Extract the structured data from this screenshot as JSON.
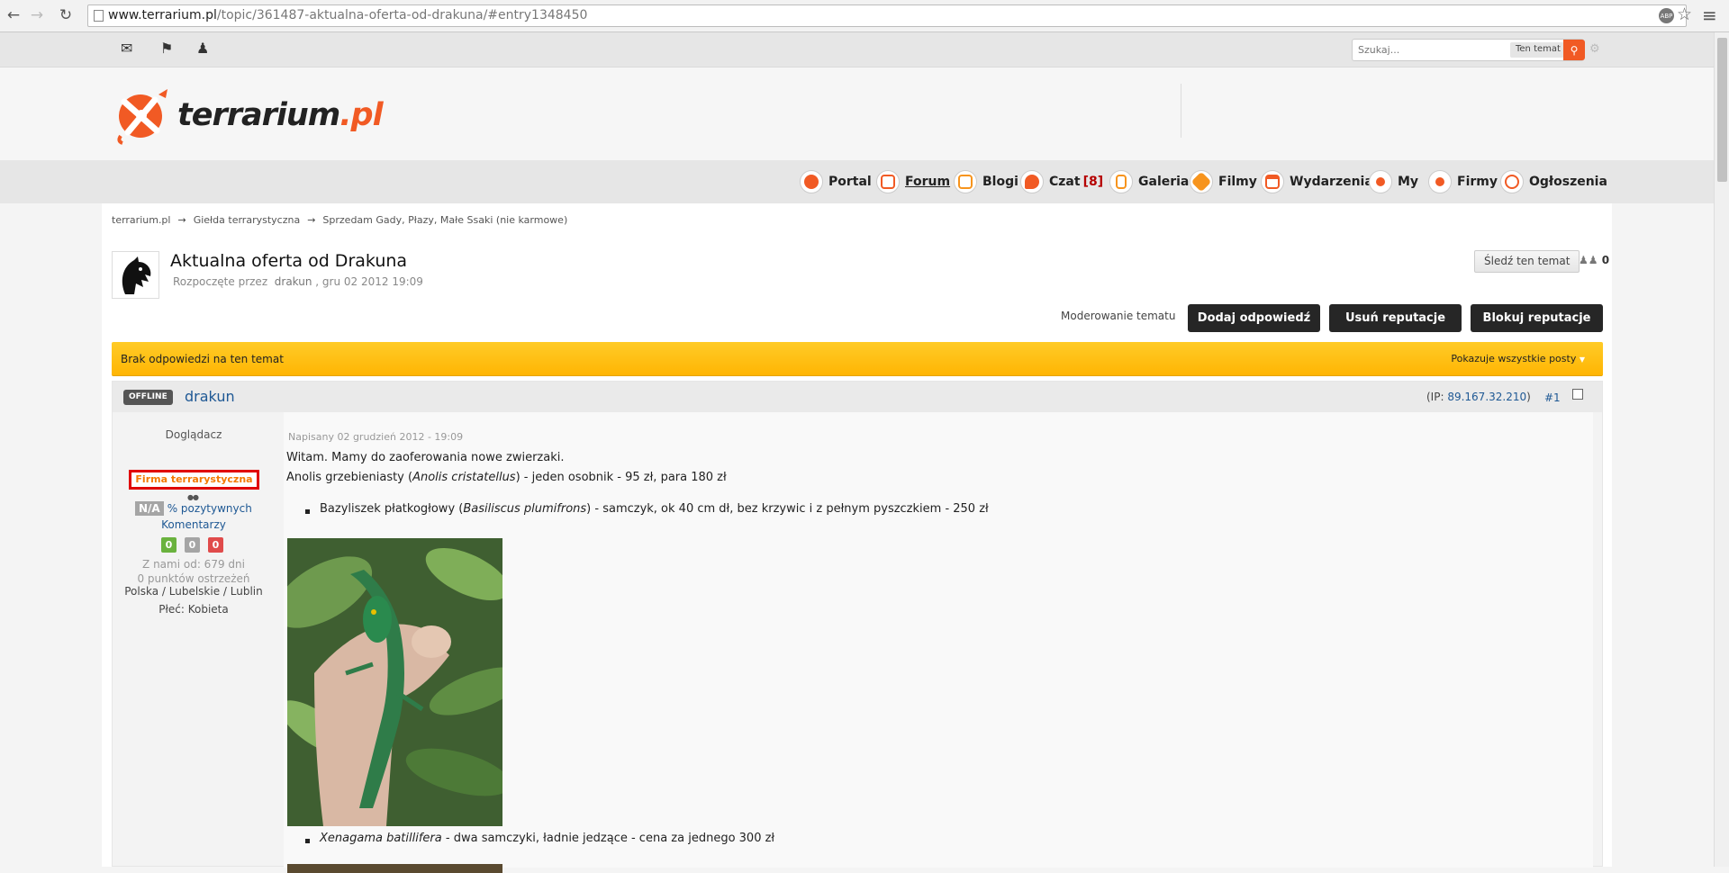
{
  "browser": {
    "url_domain": "www.terrarium.pl",
    "url_path": "/topic/361487-aktualna-oferta-od-drakuna/#entry1348450",
    "ext_label": "ABP"
  },
  "userbar": {
    "search_placeholder": "Szukaj...",
    "search_scope": "Ten temat"
  },
  "site": {
    "logo_text": "terrarium",
    "logo_suffix": ".pl",
    "brand_color": "#f15a24"
  },
  "nav": [
    {
      "label": "Portal",
      "icon": "portal-icon"
    },
    {
      "label": "Forum",
      "icon": "forum-icon"
    },
    {
      "label": "Blogi",
      "icon": "blog-icon"
    },
    {
      "label": "Czat",
      "count": "[8]",
      "icon": "chat-icon"
    },
    {
      "label": "Galeria",
      "icon": "gallery-icon"
    },
    {
      "label": "Filmy",
      "icon": "video-icon"
    },
    {
      "label": "Wydarzenia",
      "icon": "calendar-icon"
    },
    {
      "label": "My",
      "icon": "people-icon"
    },
    {
      "label": "Firmy",
      "icon": "companies-icon"
    },
    {
      "label": "Ogłoszenia",
      "icon": "ads-icon"
    }
  ],
  "breadcrumb": [
    "terrarium.pl",
    "Giełda terrarystyczna",
    "Sprzedam Gady, Płazy, Małe Ssaki (nie karmowe)"
  ],
  "breadcrumb_sep": "→",
  "topic": {
    "title": "Aktualna oferta od Drakuna",
    "started_by": "Rozpoczęte przez",
    "author": "drakun",
    "date": ", gru 02 2012 19:09",
    "follow_label": "Śledź ten temat",
    "followers": "0",
    "moderate_label": "Moderowanie tematu",
    "reply_label": "Dodaj odpowiedź",
    "remove_rep_label": "Usuń reputacje",
    "block_rep_label": "Blokuj reputacje",
    "no_replies": "Brak odpowiedzi na ten temat",
    "filter_label": "Pokazuje wszystkie posty"
  },
  "post": {
    "status": "OFFLINE",
    "author": "drakun",
    "ip_prefix": "(IP: ",
    "ip": "89.167.32.210",
    "ip_suffix": ")",
    "number": "#1",
    "author_title": "Doglądacz",
    "group": "Firma terrarystyczna",
    "pips": "●●",
    "rep_na": "N/A",
    "rep_pct": "% pozytywnych",
    "comments_label": "Komentarzy",
    "votes": [
      "0",
      "0",
      "0"
    ],
    "joined": "Z nami od: 679 dni",
    "warnings": "0 punktów ostrzeżeń",
    "location": "Polska / Lubelskie / Lublin",
    "gender": "Płeć: Kobieta",
    "date": "Napisany 02 grudzień 2012 - 19:09",
    "line1": "Witam. Mamy do zaoferowania nowe zwierzaki.",
    "line2_a": "Anolis grzebieniasty (",
    "line2_latin": "Anolis cristatellus",
    "line2_b": ") - jeden osobnik - 95 zł, para 180 zł",
    "item1_a": "Bazyliszek płatkogłowy (",
    "item1_latin": "Basiliscus plumifrons",
    "item1_b": ") - samczyk, ok 40 cm dł, bez krzywic i z pełnym pyszczkiem - 250 zł",
    "item2_latin": "Xenagama batillifera",
    "item2_b": " - dwa samczyki, ładnie jedzące - cena za jednego 300 zł"
  }
}
